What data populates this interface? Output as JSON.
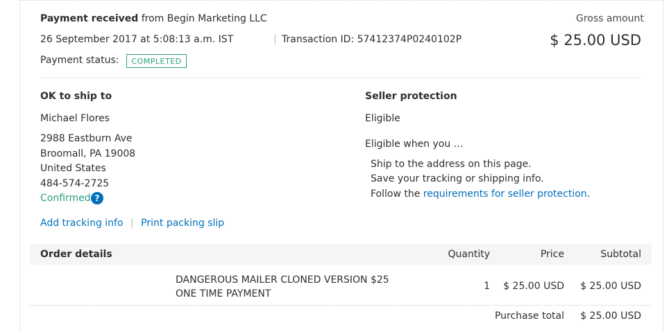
{
  "payment": {
    "received_label": "Payment received",
    "from_text": "from Begin Marketing LLC",
    "datetime": "26 September 2017 at 5:08:13 a.m. IST",
    "transaction_id": "Transaction ID: 57412374P0240102P",
    "status_label": "Payment status:",
    "status_value": "COMPLETED",
    "gross_label": "Gross amount",
    "gross_amount": "$ 25.00 USD"
  },
  "shipping": {
    "title": "OK to ship to",
    "name": "Michael Flores",
    "address_lines": [
      "2988 Eastburn Ave",
      "Broomall, PA 19008",
      "United States",
      "484-574-2725"
    ],
    "confirmed_label": "Confirmed",
    "help_icon": "?"
  },
  "seller_protection": {
    "title": "Seller protection",
    "status": "Eligible",
    "intro": "Eligible when you ...",
    "items": [
      "Ship to the address on this page.",
      "Save your tracking or shipping info."
    ],
    "follow_prefix": "Follow the",
    "follow_link": "requirements for seller protection",
    "follow_suffix": "."
  },
  "actions": {
    "add_tracking": "Add tracking info",
    "separator": "|",
    "print_slip": "Print packing slip"
  },
  "order": {
    "headers": {
      "details": "Order details",
      "quantity": "Quantity",
      "price": "Price",
      "subtotal": "Subtotal"
    },
    "items": [
      {
        "description_line1": "DANGEROUS MAILER CLONED VERSION $25",
        "description_line2": "ONE TIME PAYMENT",
        "quantity": "1",
        "price": "$ 25.00 USD",
        "subtotal": "$ 25.00 USD"
      }
    ],
    "purchase_total_label": "Purchase total",
    "purchase_total_value": "$ 25.00 USD"
  },
  "colors": {
    "link": "#0070ba",
    "completed": "#2aa17f",
    "header_bg": "#f5f5f5"
  }
}
